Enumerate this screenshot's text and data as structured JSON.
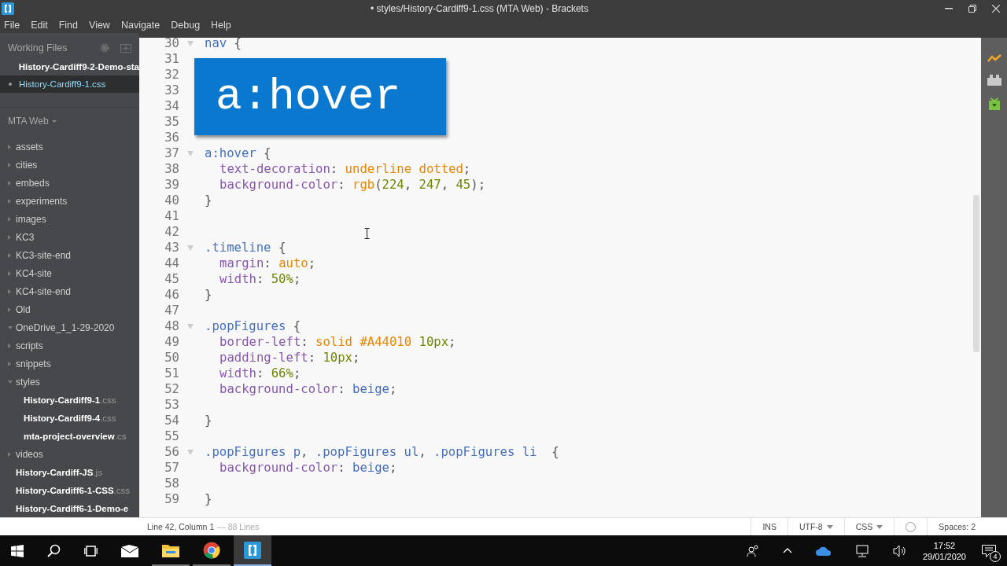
{
  "window": {
    "title": "• styles/History-Cardiff9-1.css (MTA Web) - Brackets"
  },
  "menu": [
    "File",
    "Edit",
    "Find",
    "View",
    "Navigate",
    "Debug",
    "Help"
  ],
  "sidebar": {
    "working_files_label": "Working Files",
    "working_files": [
      {
        "name": "History-Cardiff9-2-Demo-sta",
        "selected": false,
        "modified": false
      },
      {
        "name": "History-Cardiff9-1.css",
        "selected": true,
        "modified": true
      }
    ],
    "project": "MTA Web",
    "tree": [
      {
        "kind": "folder",
        "name": "assets",
        "expanded": false
      },
      {
        "kind": "folder",
        "name": "cities",
        "expanded": false
      },
      {
        "kind": "folder",
        "name": "embeds",
        "expanded": false
      },
      {
        "kind": "folder",
        "name": "experiments",
        "expanded": false
      },
      {
        "kind": "folder",
        "name": "images",
        "expanded": false
      },
      {
        "kind": "folder",
        "name": "KC3",
        "expanded": false
      },
      {
        "kind": "folder",
        "name": "KC3-site-end",
        "expanded": false
      },
      {
        "kind": "folder",
        "name": "KC4-site",
        "expanded": false
      },
      {
        "kind": "folder",
        "name": "KC4-site-end",
        "expanded": false
      },
      {
        "kind": "folder",
        "name": "Old",
        "expanded": false
      },
      {
        "kind": "folder",
        "name": "OneDrive_1_1-29-2020",
        "expanded": true
      },
      {
        "kind": "folder",
        "name": "scripts",
        "expanded": false
      },
      {
        "kind": "folder",
        "name": "snippets",
        "expanded": false
      },
      {
        "kind": "folder",
        "name": "styles",
        "expanded": true,
        "children": [
          {
            "kind": "file",
            "name": "History-Cardiff9-1",
            "ext": ".css"
          },
          {
            "kind": "file",
            "name": "History-Cardiff9-4",
            "ext": ".css"
          },
          {
            "kind": "file",
            "name": "mta-project-overview",
            "ext": ".cs"
          }
        ]
      },
      {
        "kind": "folder",
        "name": "videos",
        "expanded": false
      },
      {
        "kind": "file",
        "name": "History-Cardiff-JS",
        "ext": ".js"
      },
      {
        "kind": "file",
        "name": "History-Cardiff6-1-CSS",
        "ext": ".css"
      },
      {
        "kind": "file",
        "name": "History-Cardiff6-1-Demo-e"
      }
    ]
  },
  "editor": {
    "lines": [
      {
        "n": "30",
        "fold": true,
        "tokens": [
          {
            "kind": "s",
            "text": "nav"
          },
          {
            "kind": "p",
            "text": " {"
          }
        ]
      },
      {
        "n": "31"
      },
      {
        "n": "32"
      },
      {
        "n": "33"
      },
      {
        "n": "34"
      },
      {
        "n": "35"
      },
      {
        "n": "36"
      },
      {
        "n": "37",
        "fold": true,
        "tokens": [
          {
            "kind": "s",
            "text": "a:hover"
          },
          {
            "kind": "p",
            "text": " {"
          }
        ]
      },
      {
        "n": "38",
        "indented": true,
        "tokens": [
          {
            "kind": "pr",
            "text": "text-decoration"
          },
          {
            "kind": "p",
            "text": ": "
          },
          {
            "kind": "v",
            "text": "underline dotted"
          },
          {
            "kind": "p",
            "text": ";"
          }
        ]
      },
      {
        "n": "39",
        "indented": true,
        "tokens": [
          {
            "kind": "pr",
            "text": "background-color"
          },
          {
            "kind": "p",
            "text": ": "
          },
          {
            "kind": "v",
            "text": "rgb"
          },
          {
            "kind": "p",
            "text": "("
          },
          {
            "kind": "n",
            "text": "224"
          },
          {
            "kind": "p",
            "text": ", "
          },
          {
            "kind": "n",
            "text": "247"
          },
          {
            "kind": "p",
            "text": ", "
          },
          {
            "kind": "n",
            "text": "45"
          },
          {
            "kind": "p",
            "text": ");"
          }
        ]
      },
      {
        "n": "40",
        "tokens": [
          {
            "kind": "p",
            "text": "}"
          }
        ]
      },
      {
        "n": "41"
      },
      {
        "n": "42"
      },
      {
        "n": "43",
        "fold": true,
        "tokens": [
          {
            "kind": "s",
            "text": ".timeline"
          },
          {
            "kind": "p",
            "text": " {"
          }
        ]
      },
      {
        "n": "44",
        "indented": true,
        "tokens": [
          {
            "kind": "pr",
            "text": "margin"
          },
          {
            "kind": "p",
            "text": ": "
          },
          {
            "kind": "v",
            "text": "auto"
          },
          {
            "kind": "p",
            "text": ";"
          }
        ]
      },
      {
        "n": "45",
        "indented": true,
        "tokens": [
          {
            "kind": "pr",
            "text": "width"
          },
          {
            "kind": "p",
            "text": ": "
          },
          {
            "kind": "n",
            "text": "50%"
          },
          {
            "kind": "p",
            "text": ";"
          }
        ]
      },
      {
        "n": "46",
        "tokens": [
          {
            "kind": "p",
            "text": "}"
          }
        ]
      },
      {
        "n": "47"
      },
      {
        "n": "48",
        "fold": true,
        "tokens": [
          {
            "kind": "s",
            "text": ".popFigures"
          },
          {
            "kind": "p",
            "text": " {"
          }
        ]
      },
      {
        "n": "49",
        "indented": true,
        "tokens": [
          {
            "kind": "pr",
            "text": "border-left"
          },
          {
            "kind": "p",
            "text": ": "
          },
          {
            "kind": "v",
            "text": "solid #A44010 "
          },
          {
            "kind": "n",
            "text": "10"
          },
          {
            "kind": "n",
            "text": "px"
          },
          {
            "kind": "p",
            "text": ";"
          }
        ]
      },
      {
        "n": "50",
        "indented": true,
        "tokens": [
          {
            "kind": "pr",
            "text": "padding-left"
          },
          {
            "kind": "p",
            "text": ": "
          },
          {
            "kind": "n",
            "text": "10"
          },
          {
            "kind": "n",
            "text": "px"
          },
          {
            "kind": "p",
            "text": ";"
          }
        ]
      },
      {
        "n": "51",
        "indented": true,
        "tokens": [
          {
            "kind": "pr",
            "text": "width"
          },
          {
            "kind": "p",
            "text": ": "
          },
          {
            "kind": "n",
            "text": "66%"
          },
          {
            "kind": "p",
            "text": ";"
          }
        ]
      },
      {
        "n": "52",
        "indented": true,
        "tokens": [
          {
            "kind": "pr",
            "text": "background-color"
          },
          {
            "kind": "p",
            "text": ": "
          },
          {
            "kind": "k",
            "text": "beige"
          },
          {
            "kind": "p",
            "text": ";"
          }
        ]
      },
      {
        "n": "53"
      },
      {
        "n": "54",
        "tokens": [
          {
            "kind": "p",
            "text": "}"
          }
        ]
      },
      {
        "n": "55"
      },
      {
        "n": "56",
        "fold": true,
        "tokens": [
          {
            "kind": "s",
            "text": ".popFigures p"
          },
          {
            "kind": "p",
            "text": ", "
          },
          {
            "kind": "s",
            "text": ".popFigures ul"
          },
          {
            "kind": "p",
            "text": ", "
          },
          {
            "kind": "s",
            "text": ".popFigures li"
          },
          {
            "kind": "p",
            "text": "  {"
          }
        ]
      },
      {
        "n": "57",
        "indented": true,
        "tokens": [
          {
            "kind": "pr",
            "text": "background-color"
          },
          {
            "kind": "p",
            "text": ": "
          },
          {
            "kind": "k",
            "text": "beige"
          },
          {
            "kind": "p",
            "text": ";"
          }
        ]
      },
      {
        "n": "58"
      },
      {
        "n": "59",
        "tokens": [
          {
            "kind": "p",
            "text": "}"
          }
        ]
      }
    ],
    "overlay": "a:hover"
  },
  "status_bar": {
    "position": "Line 42, Column 1",
    "line_count": "— 88 Lines",
    "mode": "INS",
    "encoding": "UTF-8",
    "language": "CSS",
    "indent": "Spaces: 2"
  },
  "taskbar": {
    "time": "17:52",
    "date": "29/01/2020",
    "notifications": "4"
  }
}
